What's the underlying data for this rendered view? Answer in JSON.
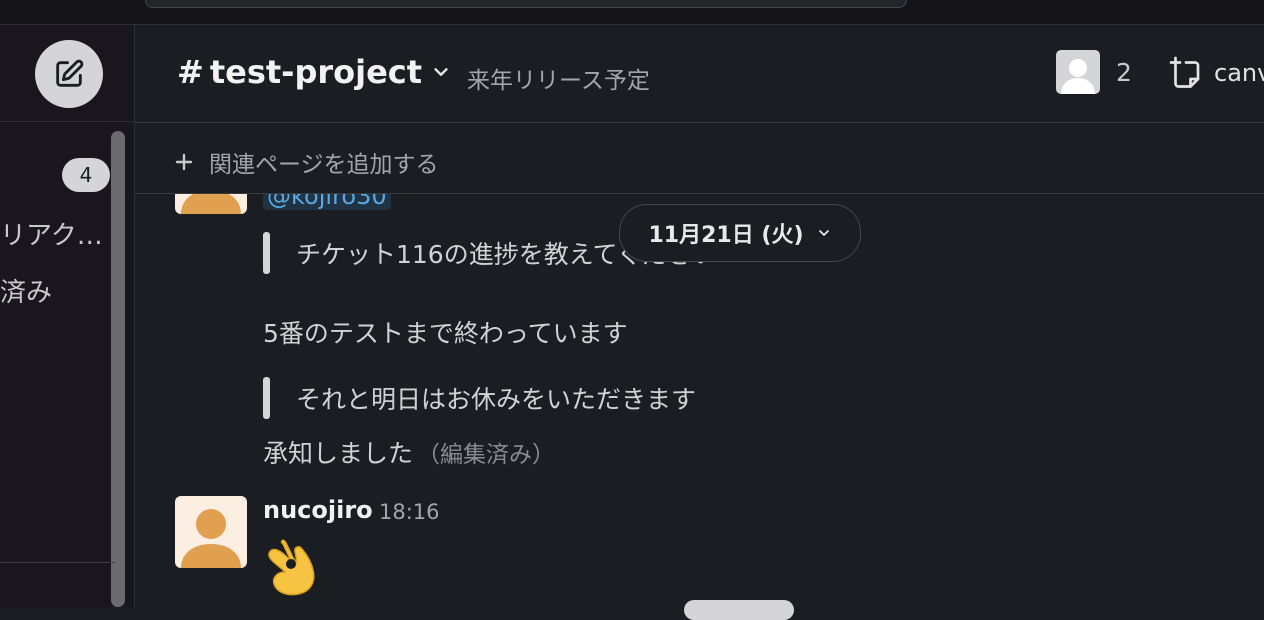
{
  "header": {
    "channel_prefix": "#",
    "channel_name": "test-project",
    "topic": "来年リリース予定",
    "member_count": "2",
    "canvas_label": "canv"
  },
  "bookmarks": {
    "add_label": "関連ページを追加する"
  },
  "sidebar": {
    "badge_count": "4",
    "items": [
      {
        "label": "リアク…"
      },
      {
        "label": "済み"
      }
    ]
  },
  "date_divider": {
    "label": "11月21日 (火)"
  },
  "messages": {
    "mention": "@kojiro30",
    "quote1": "チケット116の進捗を教えてください",
    "reply1": "5番のテストまで終わっています",
    "quote2": "それと明日はお休みをいただきます",
    "reply2": "承知しました",
    "edited_label": "（編集済み）",
    "last": {
      "author": "nucojiro",
      "time": "18:16",
      "emoji": "ok-hand"
    }
  },
  "icons": {
    "compose": "compose-icon",
    "chevron": "chevron-down-icon",
    "member_avatar": "user-avatar-icon",
    "canvas": "canvas-add-icon",
    "plus": "plus-icon"
  },
  "colors": {
    "background": "#1a1d21",
    "sidebar": "#19171d",
    "mention_text": "#5aa8e0",
    "avatar_orange": "#e0a050"
  }
}
